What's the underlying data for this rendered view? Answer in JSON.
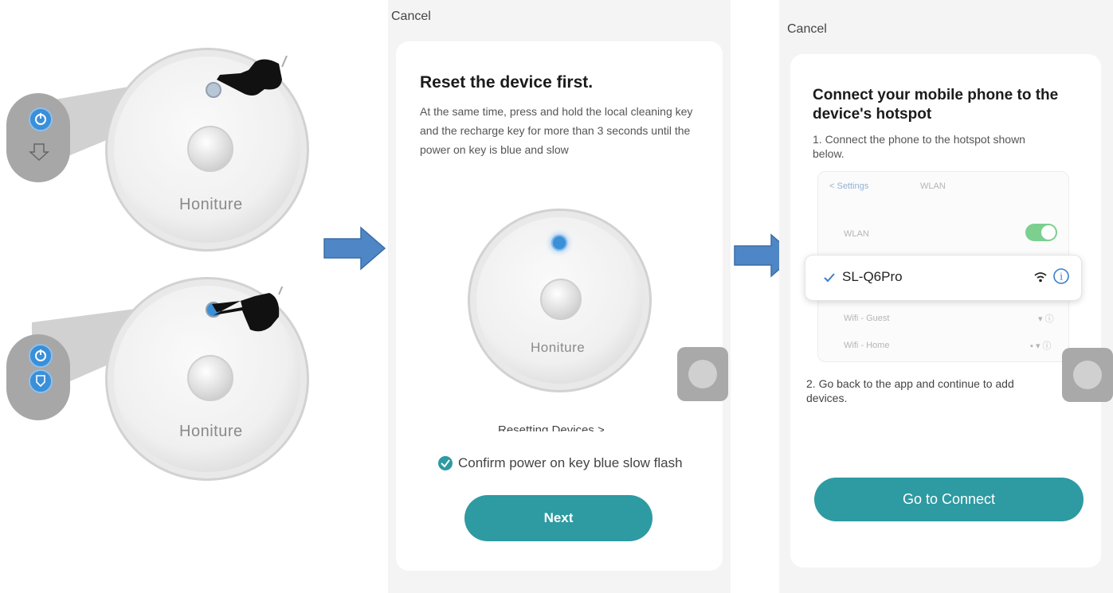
{
  "illustration": {
    "brand_top": "Honiture",
    "brand_bottom": "Honiture"
  },
  "step1": {
    "cancel_label": "Cancel",
    "title": "Reset the device first.",
    "description": "At the same time, press and hold the local cleaning key and the recharge key for more than 3 seconds until the power on key is blue and slow",
    "robot_brand": "Honiture",
    "resetting_link": "Resetting Devices >",
    "confirm_label": "Confirm power on key blue slow flash",
    "confirm_checked": true,
    "next_button": "Next"
  },
  "step2": {
    "cancel_label": "Cancel",
    "title": "Connect your mobile phone to the device's hotspot",
    "instruction_1": "1. Connect the phone to the hotspot shown below.",
    "wlan_back": "< Settings",
    "wlan_header": "WLAN",
    "wlan_toggle_label": "WLAN",
    "wlan_toggle_on": true,
    "selected_network": "SL-Q6Pro",
    "other_networks": [
      "Wifi - Guest",
      "Wifi - Home"
    ],
    "instruction_2": "2. Go back to the app and continue to add devices.",
    "connect_button": "Go to Connect"
  },
  "colors": {
    "accent": "#2e9aa2",
    "arrow": "#4f86c6",
    "power_blue": "#3a8fd9"
  },
  "icons": [
    "power-icon",
    "dock-icon",
    "finger-hand-icon",
    "right-arrow-icon",
    "checkbox-checked-icon",
    "wifi-icon",
    "info-icon",
    "checkmark-icon",
    "floating-assistive-icon"
  ]
}
